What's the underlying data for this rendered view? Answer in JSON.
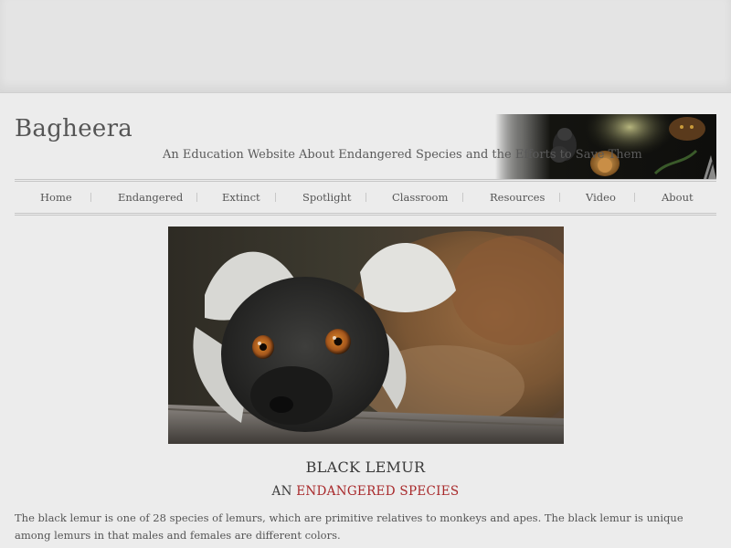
{
  "header": {
    "site_title": "Bagheera",
    "tagline": "An Education Website About Endangered Species and the Efforts to Save Them"
  },
  "nav": {
    "items": [
      "Home",
      "Endangered",
      "Extinct",
      "Spotlight",
      "Classroom",
      "Resources",
      "Video",
      "About"
    ]
  },
  "main": {
    "species_name": "BLACK LEMUR",
    "status_prefix": "AN",
    "status_highlight": "ENDANGERED SPECIES",
    "description": "The black lemur is one of 28 species of lemurs, which are primitive relatives to monkeys and apes. The black lemur is unique among lemurs in that males and females are different colors."
  },
  "colors": {
    "status_accent": "#a8282a",
    "page_background": "#ececec"
  }
}
